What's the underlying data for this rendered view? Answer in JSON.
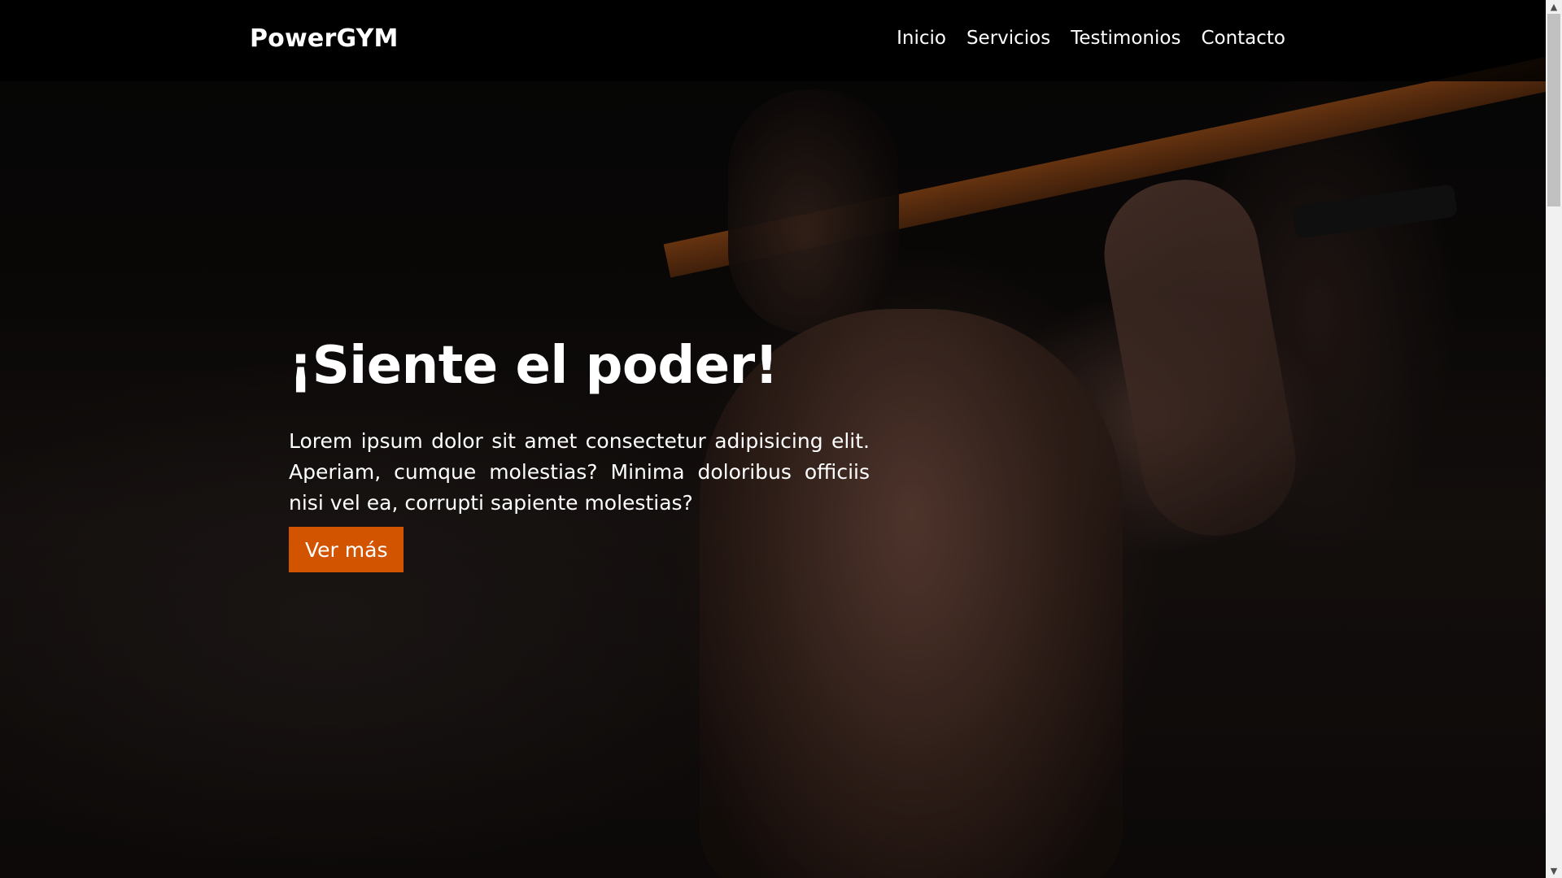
{
  "brand": {
    "logo": "PowerGYM"
  },
  "nav": {
    "items": [
      {
        "label": "Inicio"
      },
      {
        "label": "Servicios"
      },
      {
        "label": "Testimonios"
      },
      {
        "label": "Contacto"
      }
    ]
  },
  "hero": {
    "title": "¡Siente el poder!",
    "text": "Lorem ipsum dolor sit amet consectetur adipisicing elit. Aperiam, cumque molestias? Minima doloribus officiis nisi vel ea, corrupti sapiente molestias?",
    "button_label": "Ver más",
    "background_image": "man-doing-pull-ups-on-orange-bar"
  },
  "colors": {
    "accent": "#d35400",
    "header_bg": "#000000",
    "text": "#ffffff"
  },
  "icons": {
    "scroll_up": "chevron-up-icon",
    "scroll_down": "chevron-down-icon"
  }
}
